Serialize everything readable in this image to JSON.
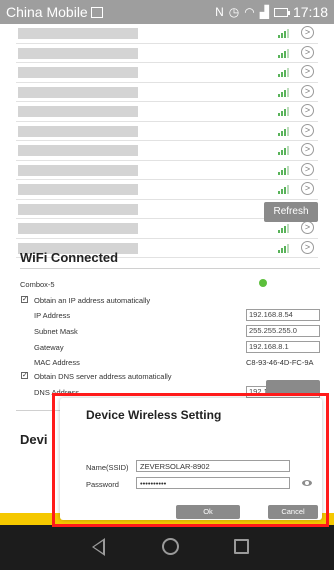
{
  "status_bar": {
    "carrier": "China Mobile",
    "time": "17:18"
  },
  "wifi_list": {
    "rows": 12,
    "refresh_label": "Refresh"
  },
  "wifi_connected": {
    "title": "WiFi Connected",
    "network_name": "Combox-5",
    "obtain_ip_label": "Obtain an IP address automatically",
    "obtain_ip_checked": true,
    "ip_label": "IP Address",
    "ip_value": "192.168.8.54",
    "subnet_label": "Subnet Mask",
    "subnet_value": "255.255.255.0",
    "gateway_label": "Gateway",
    "gateway_value": "192.168.8.1",
    "mac_label": "MAC Address",
    "mac_value": "C8-93-46-4D-FC-9A",
    "obtain_dns_label": "Obtain DNS server address automatically",
    "obtain_dns_checked": true,
    "dns_label": "DNS Address",
    "dns_value": "192.168.9.20"
  },
  "device_section_partial": "Devi",
  "dialog": {
    "title": "Device Wireless Setting",
    "ssid_label": "Name(SSID)",
    "ssid_value": "ZEVERSOLAR-8902",
    "password_label": "Password",
    "password_value": "••••••••••",
    "ok_label": "Ok",
    "cancel_label": "Cancel"
  },
  "colors": {
    "status_bar": "#9e9e9e",
    "button_gray": "#8a8a8a",
    "highlight_red": "#ff1a1a",
    "connected_green": "#5cbf3c",
    "yellow_strip": "#f5c800",
    "nav_bar": "#1c1c1c"
  }
}
